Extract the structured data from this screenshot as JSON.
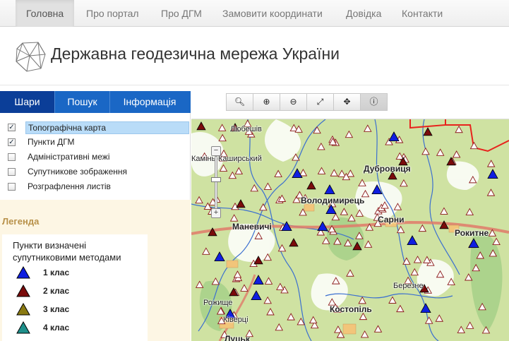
{
  "nav": {
    "items": [
      "Головна",
      "Про портал",
      "Про ДГМ",
      "Замовити координати",
      "Довідка",
      "Контакти"
    ],
    "active_index": 0
  },
  "header": {
    "title": "Державна геодезична мережа України"
  },
  "panel": {
    "tabs": [
      "Шари",
      "Пошук",
      "Інформація"
    ],
    "active_tab": 0,
    "layers": [
      {
        "label": "Топографічна карта",
        "checked": true
      },
      {
        "label": "Пункти ДГМ",
        "checked": true
      },
      {
        "label": "Адміністративні межі",
        "checked": false
      },
      {
        "label": "Супутникове зображення",
        "checked": false
      },
      {
        "label": "Розграфлення листів",
        "checked": false
      }
    ],
    "legend_title": "Легенда",
    "legend_caption": "Пункти визначені супутниковими методами",
    "legend_items": [
      {
        "label": "1 клас",
        "color": "#0f1ee0",
        "icon": "blue-triangle-icon"
      },
      {
        "label": "2 клас",
        "color": "#7a0b0b",
        "icon": "dark-red-triangle-icon"
      },
      {
        "label": "3 клас",
        "color": "#8a7a12",
        "icon": "olive-triangle-icon"
      },
      {
        "label": "4 клас",
        "color": "#1e8f8a",
        "icon": "teal-triangle-icon"
      }
    ]
  },
  "map": {
    "toolbar": [
      {
        "name": "zoom-extent-button",
        "icon": "magnifier-icon"
      },
      {
        "name": "zoom-in-button",
        "icon": "zoom-in-icon"
      },
      {
        "name": "zoom-out-button",
        "icon": "zoom-out-icon"
      },
      {
        "name": "full-extent-button",
        "icon": "expand-icon"
      },
      {
        "name": "pan-button",
        "icon": "move-icon"
      },
      {
        "name": "info-button",
        "icon": "info-icon"
      }
    ],
    "zoom_plus": "+",
    "zoom_minus": "−",
    "places": [
      "Любешів",
      "Камінь-Каширський",
      "Дубровиця",
      "Володимирець",
      "Маневичі",
      "Сарни",
      "Рокитне",
      "Березне",
      "Рожище",
      "Костопіль",
      "Ківерці",
      "Луцьк"
    ],
    "colors": {
      "class1": "#0f1ee0",
      "class2": "#7a0b0b",
      "hollow_fill": "#ffffff",
      "hollow_stroke": "#8b1a1a",
      "border": "#e8221c",
      "road": "#e07a6a",
      "river": "#3b6fd0"
    }
  }
}
